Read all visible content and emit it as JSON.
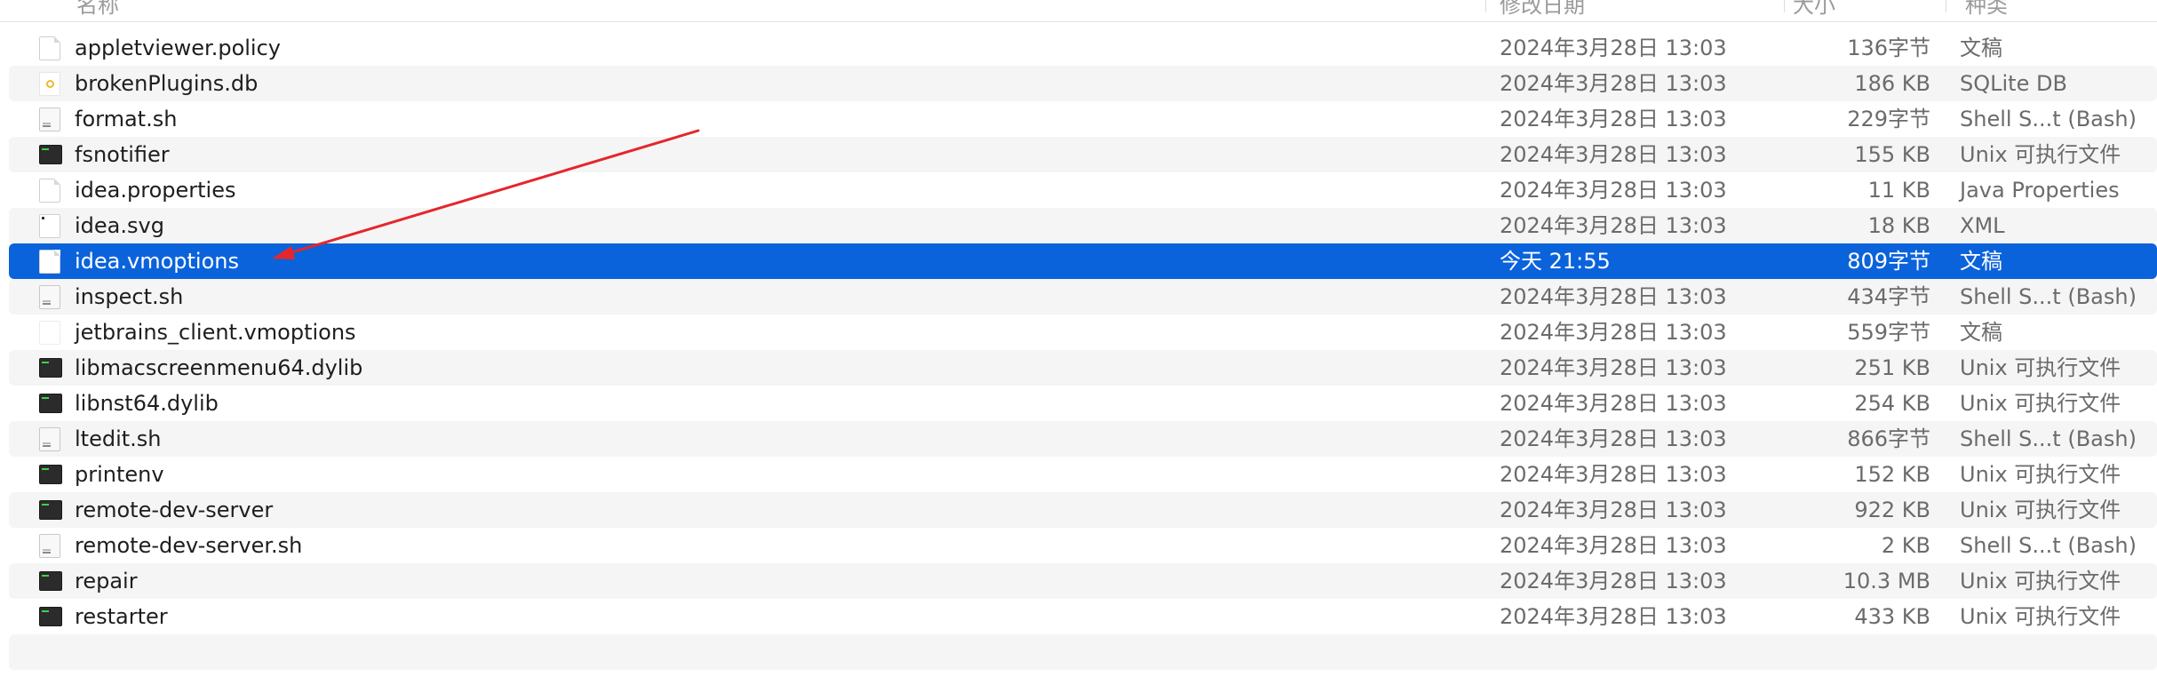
{
  "header": {
    "name_label": "名称",
    "date_label": "修改日期",
    "size_label": "大小",
    "kind_label": "种类"
  },
  "files": [
    {
      "name": "appletviewer.policy",
      "date": "2024年3月28日 13:03",
      "size": "136字节",
      "kind": "文稿",
      "icon": "document-icon"
    },
    {
      "name": "brokenPlugins.db",
      "date": "2024年3月28日 13:03",
      "size": "186 KB",
      "kind": "SQLite DB",
      "icon": "database-icon"
    },
    {
      "name": "format.sh",
      "date": "2024年3月28日 13:03",
      "size": "229字节",
      "kind": "Shell S...t (Bash)",
      "icon": "script-icon"
    },
    {
      "name": "fsnotifier",
      "date": "2024年3月28日 13:03",
      "size": "155 KB",
      "kind": "Unix 可执行文件",
      "icon": "executable-icon"
    },
    {
      "name": "idea.properties",
      "date": "2024年3月28日 13:03",
      "size": "11 KB",
      "kind": "Java Properties",
      "icon": "document-icon"
    },
    {
      "name": "idea.svg",
      "date": "2024年3月28日 13:03",
      "size": "18 KB",
      "kind": "XML",
      "icon": "svg-icon"
    },
    {
      "name": "idea.vmoptions",
      "date": "今天 21:55",
      "size": "809字节",
      "kind": "文稿",
      "icon": "document-icon",
      "selected": true
    },
    {
      "name": "inspect.sh",
      "date": "2024年3月28日 13:03",
      "size": "434字节",
      "kind": "Shell S...t (Bash)",
      "icon": "script-icon"
    },
    {
      "name": "jetbrains_client.vmoptions",
      "date": "2024年3月28日 13:03",
      "size": "559字节",
      "kind": "文稿",
      "icon": "blank-document-icon"
    },
    {
      "name": "libmacscreenmenu64.dylib",
      "date": "2024年3月28日 13:03",
      "size": "251 KB",
      "kind": "Unix 可执行文件",
      "icon": "executable-icon"
    },
    {
      "name": "libnst64.dylib",
      "date": "2024年3月28日 13:03",
      "size": "254 KB",
      "kind": "Unix 可执行文件",
      "icon": "executable-icon"
    },
    {
      "name": "ltedit.sh",
      "date": "2024年3月28日 13:03",
      "size": "866字节",
      "kind": "Shell S...t (Bash)",
      "icon": "script-icon"
    },
    {
      "name": "printenv",
      "date": "2024年3月28日 13:03",
      "size": "152 KB",
      "kind": "Unix 可执行文件",
      "icon": "executable-icon"
    },
    {
      "name": "remote-dev-server",
      "date": "2024年3月28日 13:03",
      "size": "922 KB",
      "kind": "Unix 可执行文件",
      "icon": "executable-icon"
    },
    {
      "name": "remote-dev-server.sh",
      "date": "2024年3月28日 13:03",
      "size": "2 KB",
      "kind": "Shell S...t (Bash)",
      "icon": "script-icon"
    },
    {
      "name": "repair",
      "date": "2024年3月28日 13:03",
      "size": "10.3 MB",
      "kind": "Unix 可执行文件",
      "icon": "executable-icon"
    },
    {
      "name": "restarter",
      "date": "2024年3月28日 13:03",
      "size": "433 KB",
      "kind": "Unix 可执行文件",
      "icon": "executable-icon"
    }
  ],
  "colors": {
    "selection": "#0b63dc",
    "alt_row": "#f5f5f5",
    "annotation_arrow": "#e5262a"
  }
}
